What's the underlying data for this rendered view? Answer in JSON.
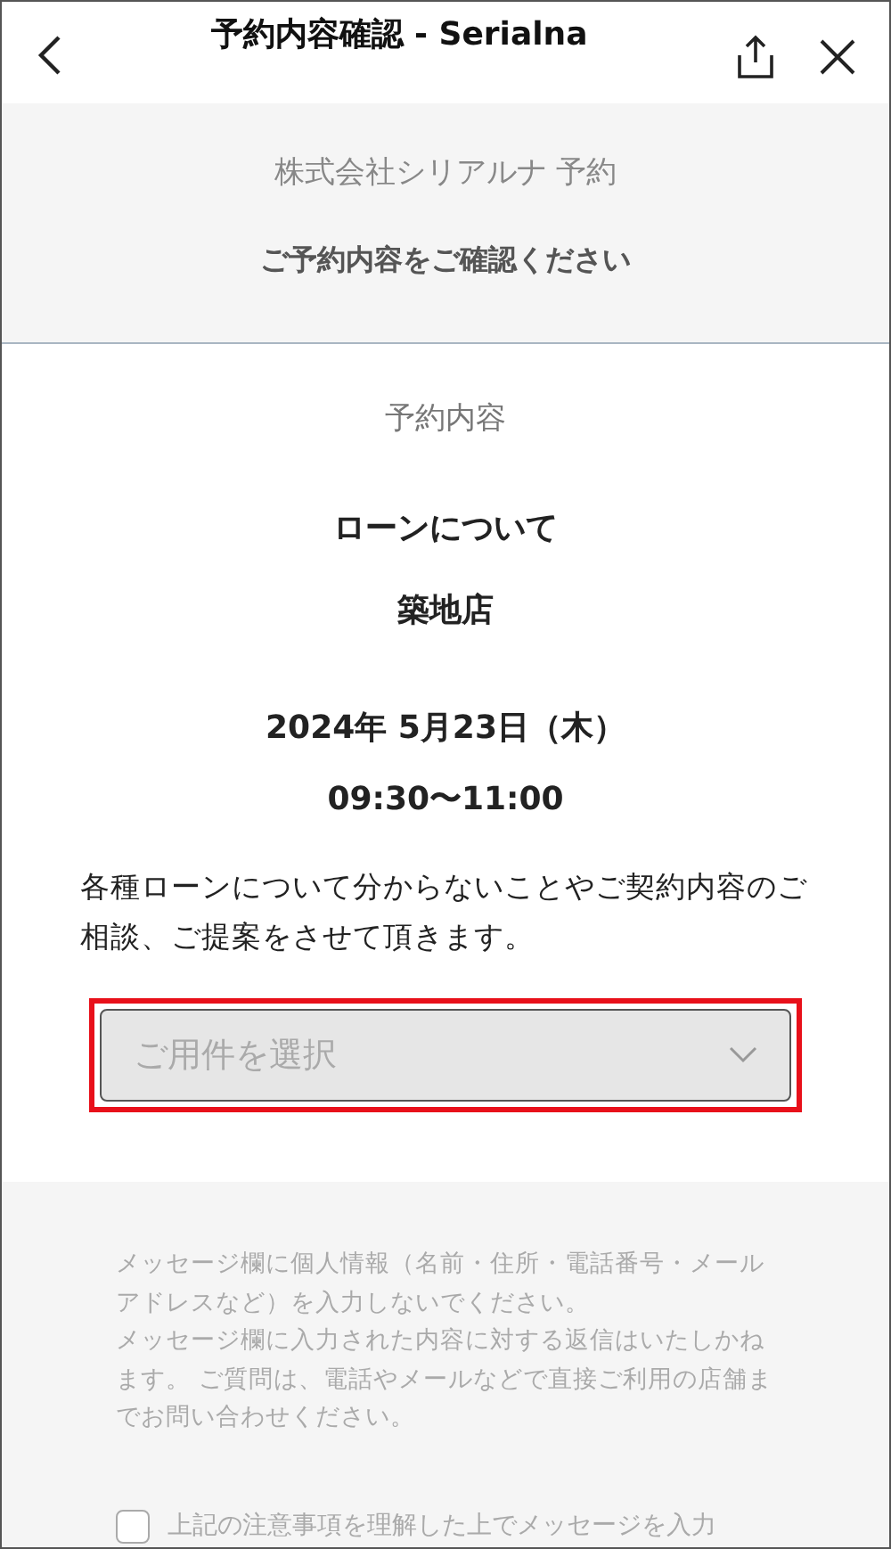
{
  "header": {
    "title": "予約内容確認 - Serialna"
  },
  "intro": {
    "company": "株式会社シリアルナ 予約",
    "heading": "ご予約内容をご確認ください"
  },
  "reservation": {
    "label": "予約内容",
    "menu": "ローンについて",
    "store": "築地店",
    "date": "2024年 5月23日（木）",
    "time": "09:30〜11:00",
    "description": "各種ローンについて分からないことやご契約内容のご相談、ご提案をさせて頂きます。"
  },
  "purpose_select": {
    "placeholder": "ご用件を選択",
    "highlighted": true
  },
  "notice": [
    "メッセージ欄に個人情報（名前・住所・電話番号・メールアドレスなど）を入力しないでください。",
    "メッセージ欄に入力された内容に対する返信はいたしかねます。 ご質問は、電話やメールなどで直接ご利用の店舗までお問い合わせください。"
  ],
  "agreement": {
    "label": "上記の注意事項を理解した上でメッセージを入力",
    "checked": false
  }
}
